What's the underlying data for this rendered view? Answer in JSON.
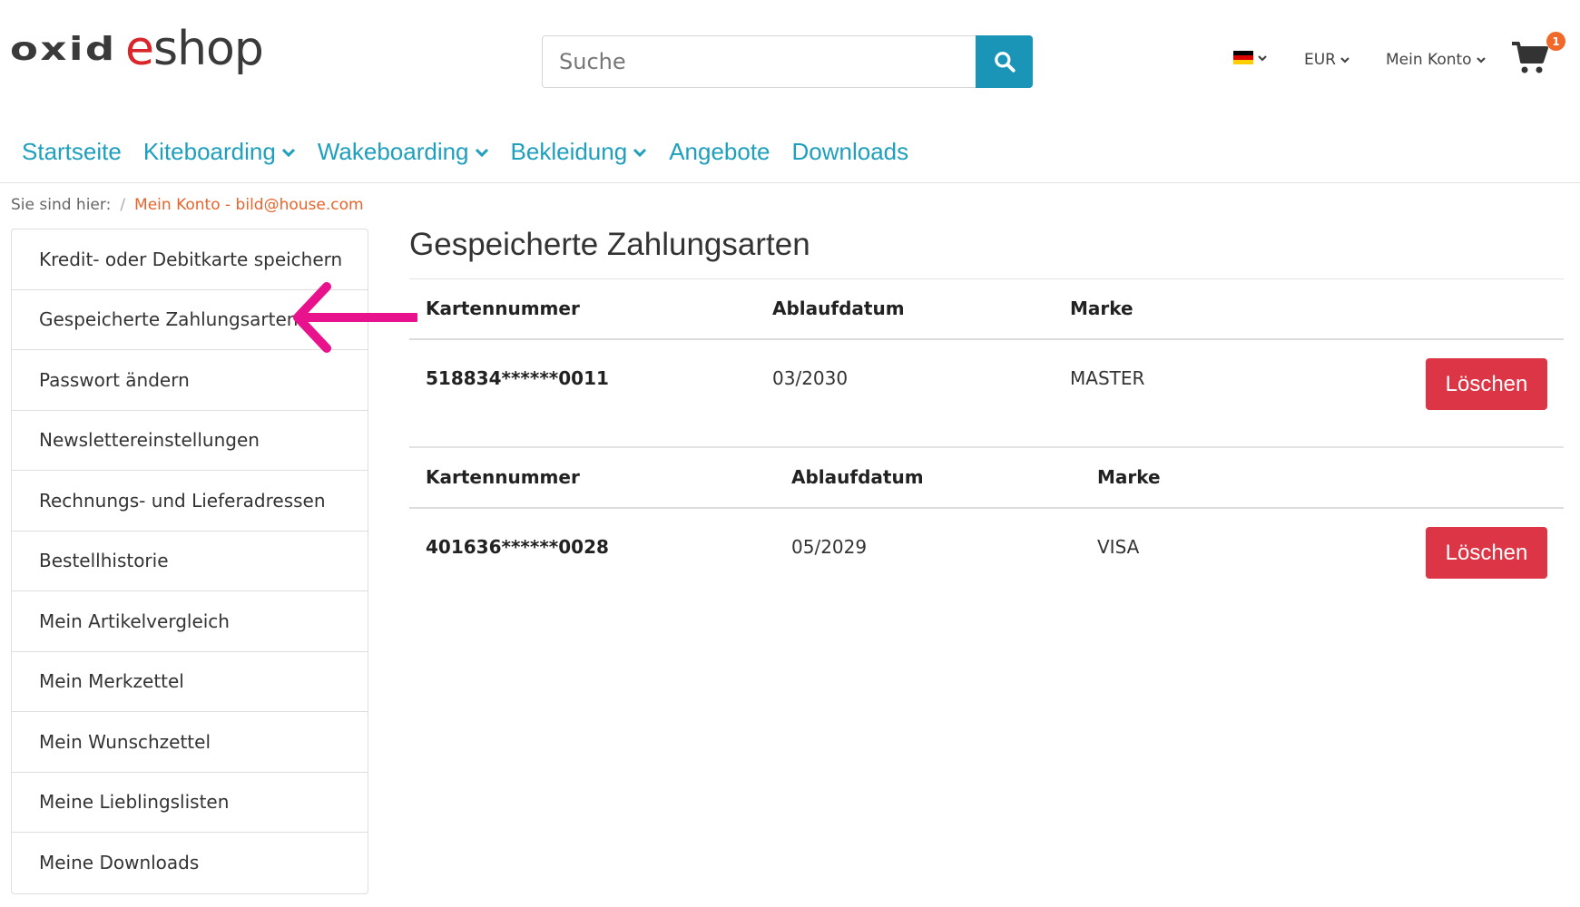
{
  "header": {
    "logo_left": "oxid",
    "logo_right": "eshop",
    "search_placeholder": "Suche",
    "currency": "EUR",
    "account": "Mein Konto",
    "cart_count": "1",
    "language_flag": "de-flag-icon"
  },
  "nav": {
    "items": [
      {
        "label": "Startseite"
      },
      {
        "label": "Kiteboarding"
      },
      {
        "label": "Wakeboarding"
      },
      {
        "label": "Bekleidung"
      },
      {
        "label": "Angebote"
      },
      {
        "label": "Downloads"
      }
    ]
  },
  "breadcrumb": {
    "label": "Sie sind hier:",
    "separator": "/",
    "current": "Mein Konto - bild@house.com"
  },
  "sidebar": {
    "items": [
      {
        "label": "Kredit- oder Debitkarte speichern"
      },
      {
        "label": "Gespeicherte Zahlungsarten"
      },
      {
        "label": "Passwort ändern"
      },
      {
        "label": "Newslettereinstellungen"
      },
      {
        "label": "Rechnungs- und Lieferadressen"
      },
      {
        "label": "Bestellhistorie"
      },
      {
        "label": "Mein Artikelvergleich"
      },
      {
        "label": "Mein Merkzettel"
      },
      {
        "label": "Mein Wunschzettel"
      },
      {
        "label": "Meine Lieblingslisten"
      },
      {
        "label": "Meine Downloads"
      }
    ]
  },
  "main": {
    "title": "Gespeicherte Zahlungsarten",
    "cards": [
      {
        "headers": {
          "number": "Kartennummer",
          "expiry": "Ablaufdatum",
          "brand": "Marke"
        },
        "number": "518834******0011",
        "expiry": "03/2030",
        "brand": "MASTER",
        "delete_label": "Löschen"
      },
      {
        "headers": {
          "number": "Kartennummer",
          "expiry": "Ablaufdatum",
          "brand": "Marke"
        },
        "number": "401636******0028",
        "expiry": "05/2029",
        "brand": "VISA",
        "delete_label": "Löschen"
      }
    ]
  },
  "colors": {
    "accent": "#1a95b8",
    "nav": "#1d9fbd",
    "breadcrumb": "#e8642b",
    "danger": "#dc3545",
    "badge": "#f0692b",
    "annotation": "#e8128c"
  }
}
